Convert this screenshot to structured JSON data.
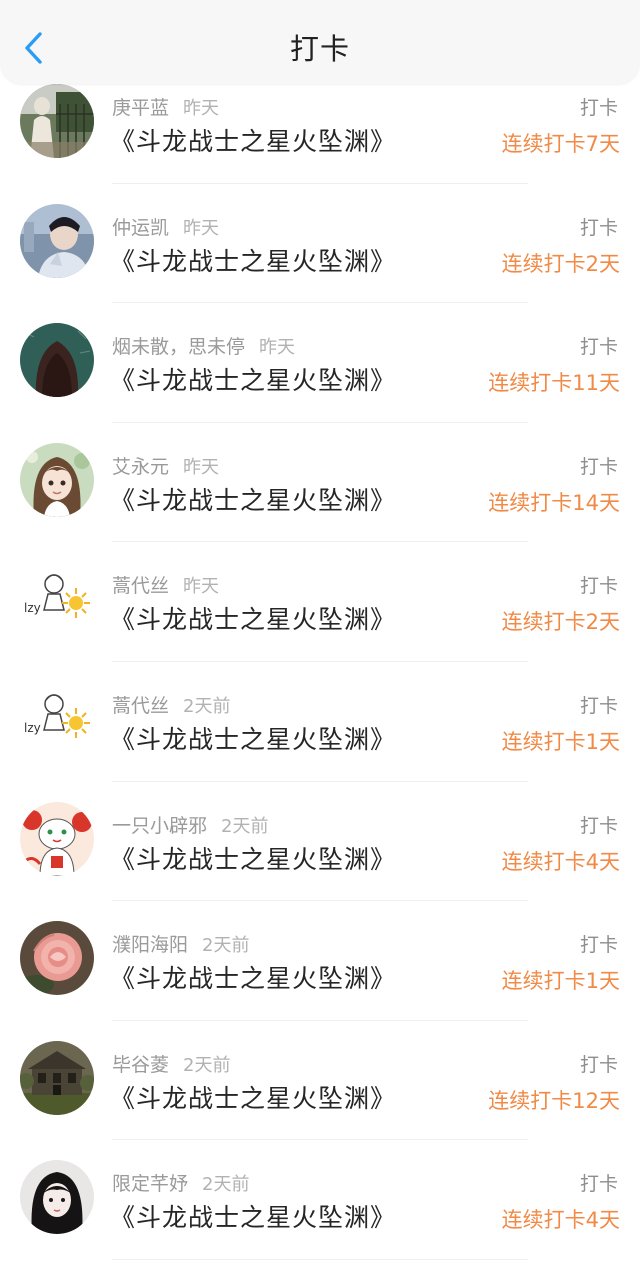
{
  "header": {
    "title": "打卡",
    "back_icon": "chevron-left-icon",
    "back_color": "#2b9cf5"
  },
  "colors": {
    "streak": "#f08a46",
    "action": "#8e8e8e",
    "name": "#9a9a9a"
  },
  "items": [
    {
      "name": "庚平蓝",
      "time": "昨天",
      "book": "《斗龙战士之星火坠渊》",
      "action": "打卡",
      "streak": "连续打卡7天"
    },
    {
      "name": "仲运凯",
      "time": "昨天",
      "book": "《斗龙战士之星火坠渊》",
      "action": "打卡",
      "streak": "连续打卡2天"
    },
    {
      "name": "烟未散，思未停",
      "time": "昨天",
      "book": "《斗龙战士之星火坠渊》",
      "action": "打卡",
      "streak": "连续打卡11天"
    },
    {
      "name": "艾永元",
      "time": "昨天",
      "book": "《斗龙战士之星火坠渊》",
      "action": "打卡",
      "streak": "连续打卡14天"
    },
    {
      "name": "蒿代丝",
      "time": "昨天",
      "book": "《斗龙战士之星火坠渊》",
      "action": "打卡",
      "streak": "连续打卡2天"
    },
    {
      "name": "蒿代丝",
      "time": "2天前",
      "book": "《斗龙战士之星火坠渊》",
      "action": "打卡",
      "streak": "连续打卡1天"
    },
    {
      "name": "一只小辟邪",
      "time": "2天前",
      "book": "《斗龙战士之星火坠渊》",
      "action": "打卡",
      "streak": "连续打卡4天"
    },
    {
      "name": "濮阳海阳",
      "time": "2天前",
      "book": "《斗龙战士之星火坠渊》",
      "action": "打卡",
      "streak": "连续打卡1天"
    },
    {
      "name": "毕谷菱",
      "time": "2天前",
      "book": "《斗龙战士之星火坠渊》",
      "action": "打卡",
      "streak": "连续打卡12天"
    },
    {
      "name": "限定芊妤",
      "time": "2天前",
      "book": "《斗龙战士之星火坠渊》",
      "action": "打卡",
      "streak": "连续打卡4天"
    }
  ]
}
